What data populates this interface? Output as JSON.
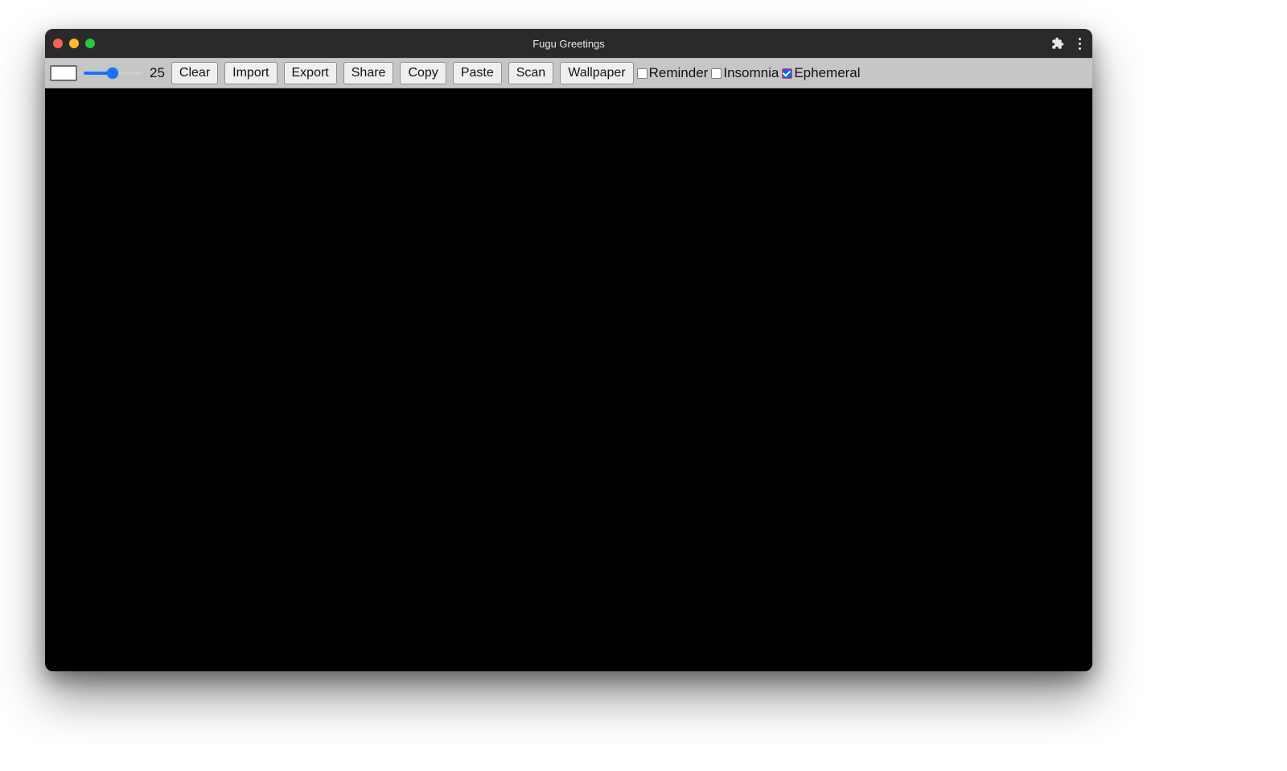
{
  "window": {
    "title": "Fugu Greetings"
  },
  "toolbar": {
    "slider_value": "25",
    "buttons": {
      "clear": "Clear",
      "import": "Import",
      "export": "Export",
      "share": "Share",
      "copy": "Copy",
      "paste": "Paste",
      "scan": "Scan",
      "wallpaper": "Wallpaper"
    },
    "checkboxes": {
      "reminder": {
        "label": "Reminder",
        "checked": false
      },
      "insomnia": {
        "label": "Insomnia",
        "checked": false
      },
      "ephemeral": {
        "label": "Ephemeral",
        "checked": true
      }
    }
  },
  "icons": {
    "extension": "puzzle-icon",
    "menu": "kebab-menu-icon"
  }
}
